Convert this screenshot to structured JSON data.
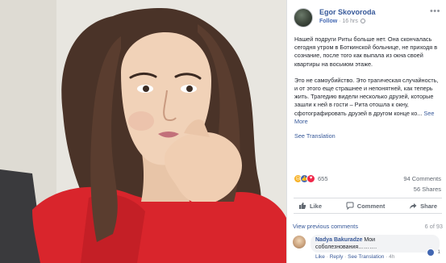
{
  "post": {
    "author": "Egor Skovoroda",
    "follow_label": "Follow",
    "timestamp": "16 hrs",
    "menu_icon": "more-dots-icon",
    "text": {
      "paragraph1": "Нашей подруги Риты больше нет. Она скончалась сегодня утром в Боткинской больнице, не приходя в сознание, после того как выпала из окна своей квартиры на восьмом этаже.",
      "paragraph2": "Это не самоубийство. Это трагическая случайность, и от этого еще страшнее и непонятней, как теперь жить. Трагедию видели несколько друзей, которые зашли к ней в гости – Рита отошла к окну, сфотографировать друзей в другом конце ко...",
      "see_more": "See More"
    },
    "see_translation": "See Translation",
    "reactions": {
      "icons": [
        "sad-reaction-icon",
        "like-reaction-icon",
        "love-reaction-icon"
      ],
      "count": "655"
    },
    "comments_count": "94 Comments",
    "shares_count": "56 Shares",
    "actions": {
      "like": "Like",
      "comment": "Comment",
      "share": "Share"
    }
  },
  "comments": {
    "view_previous": "View previous comments",
    "page": "6 of 93",
    "items": [
      {
        "name": "Nadya Bakuradze",
        "text": "Мои соболезнования……….",
        "like_label": "Like",
        "reply_label": "Reply",
        "see_translation": "See Translation",
        "time": "4h",
        "likes": "1"
      }
    ]
  },
  "colors": {
    "link_blue": "#365899",
    "brand_blue": "#4267b2",
    "muted_gray": "#90949c",
    "sweater_red": "#d9252c"
  }
}
